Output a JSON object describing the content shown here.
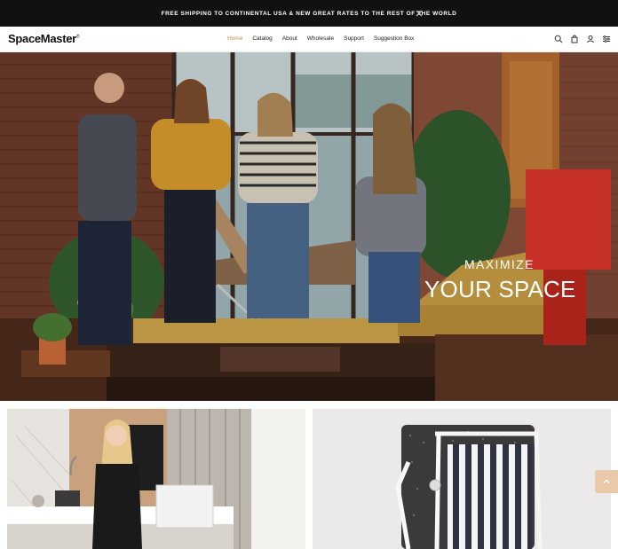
{
  "announcement": {
    "text": "FREE SHIPPING TO CONTINENTAL USA & NEW GREAT RATES TO THE REST OF THE WORLD",
    "close_icon": "close-icon"
  },
  "header": {
    "logo": "SpaceMaster",
    "logo_mark": "®",
    "nav": [
      {
        "label": "Home",
        "active": true
      },
      {
        "label": "Catalog"
      },
      {
        "label": "About"
      },
      {
        "label": "Wholesale"
      },
      {
        "label": "Support"
      },
      {
        "label": "Suggestion Box"
      }
    ],
    "icons": [
      "search-icon",
      "bag-icon",
      "account-icon",
      "settings-icon"
    ],
    "accent_color": "#c0894f"
  },
  "hero": {
    "subtitle": "MAXIMIZE",
    "title": "YOUR SPACE"
  },
  "tiles": [
    {
      "name": "kitchen-lifestyle-image"
    },
    {
      "name": "folding-bed-product-image"
    }
  ],
  "scroll_top_icon": "chevron-up-icon"
}
